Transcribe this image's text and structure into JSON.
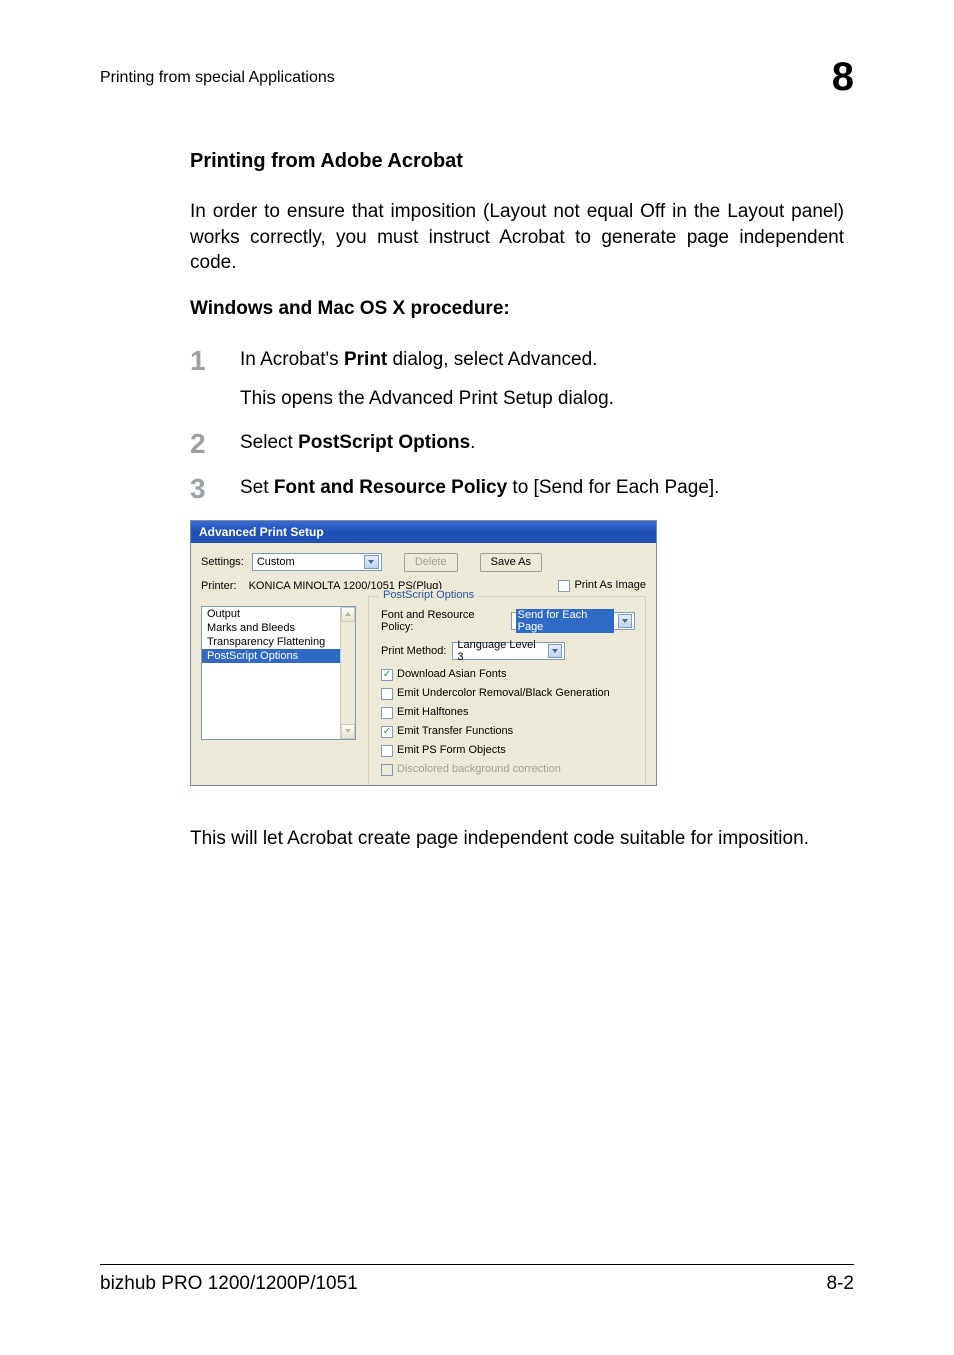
{
  "header": {
    "title": "Printing from special Applications",
    "chapter": "8"
  },
  "content": {
    "section_heading": "Printing from Adobe Acrobat",
    "intro_para": "In order to ensure that imposition (Layout not equal Off in the Layout panel) works correctly, you must instruct Acrobat to generate page independent code.",
    "sub_heading": "Windows and Mac OS X procedure:",
    "steps": {
      "s1": {
        "num": "1",
        "before_bold": "In Acrobat's ",
        "bold": "Print",
        "after_bold": " dialog, select Advanced.",
        "sub": "This opens the Advanced Print Setup dialog."
      },
      "s2": {
        "num": "2",
        "before_bold": "Select ",
        "bold": "PostScript Options",
        "after_bold": "."
      },
      "s3": {
        "num": "3",
        "before_bold": "Set ",
        "bold": "Font and Resource Policy",
        "after_bold": " to [Send for Each Page]."
      }
    },
    "closing_para": "This will let Acrobat create page independent code suitable for imposition."
  },
  "dialog": {
    "title": "Advanced Print Setup",
    "settings_label": "Settings:",
    "settings_value": "Custom",
    "delete_btn": "Delete",
    "save_as_btn": "Save As",
    "printer_label": "Printer:",
    "printer_value": "KONICA MINOLTA 1200/1051 PS(Plug)",
    "print_as_image": "Print As Image",
    "listbox": {
      "i0": "Output",
      "i1": "Marks and Bleeds",
      "i2": "Transparency Flattening",
      "i3": "PostScript Options"
    },
    "fieldset_legend": "PostScript Options",
    "font_policy_label": "Font and Resource Policy:",
    "font_policy_value": "Send for Each Page",
    "print_method_label": "Print Method:",
    "print_method_value": "Language Level 3",
    "chk_download_asian": "Download Asian Fonts",
    "chk_emit_ucr": "Emit Undercolor Removal/Black Generation",
    "chk_emit_halftones": "Emit Halftones",
    "chk_emit_transfer": "Emit Transfer Functions",
    "chk_emit_psform": "Emit PS Form Objects",
    "chk_discolored": "Discolored background correction"
  },
  "footer": {
    "product": "bizhub PRO 1200/1200P/1051",
    "page": "8-2"
  }
}
